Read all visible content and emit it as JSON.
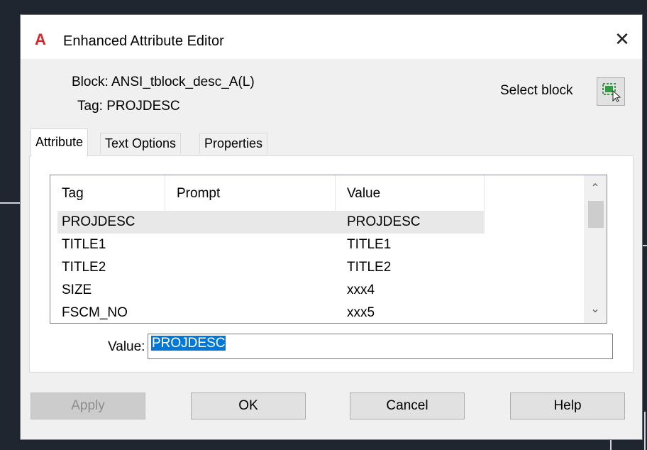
{
  "dialog": {
    "title": "Enhanced Attribute Editor",
    "logo_letter": "A",
    "close_glyph": "✕"
  },
  "block_info": {
    "block_label": "Block: ANSI_tblock_desc_A(L)",
    "tag_label": "Tag: PROJDESC",
    "select_block_label": "Select block",
    "select_block_icon": "select-block-icon"
  },
  "tabs": [
    {
      "label": "Attribute",
      "active": true
    },
    {
      "label": "Text Options",
      "active": false
    },
    {
      "label": "Properties",
      "active": false
    }
  ],
  "attribute_list": {
    "columns": [
      "Tag",
      "Prompt",
      "Value"
    ],
    "rows": [
      {
        "tag": "PROJDESC",
        "prompt": "",
        "value": "PROJDESC",
        "selected": true
      },
      {
        "tag": "TITLE1",
        "prompt": "",
        "value": "TITLE1",
        "selected": false
      },
      {
        "tag": "TITLE2",
        "prompt": "",
        "value": "TITLE2",
        "selected": false
      },
      {
        "tag": "SIZE",
        "prompt": "",
        "value": "xxx4",
        "selected": false
      },
      {
        "tag": "FSCM_NO",
        "prompt": "",
        "value": "xxx5",
        "selected": false
      }
    ],
    "scroll_up_glyph": "⌃",
    "scroll_down_glyph": "⌄"
  },
  "value_field": {
    "label": "Value:",
    "value": "PROJDESC"
  },
  "buttons": {
    "apply": "Apply",
    "ok": "OK",
    "cancel": "Cancel",
    "help": "Help"
  },
  "colors": {
    "accent_selection": "#0078d7",
    "logo_red": "#d22a2a",
    "select_icon_green": "#2e9e3e"
  }
}
